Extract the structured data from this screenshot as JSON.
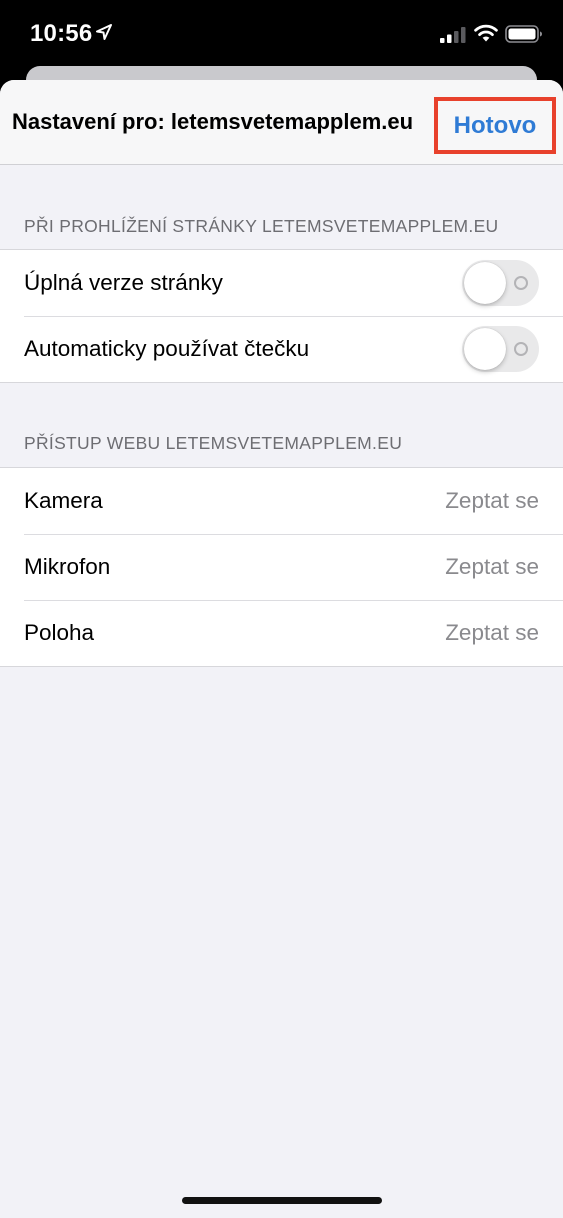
{
  "status_bar": {
    "time": "10:56"
  },
  "nav": {
    "title": "Nastavení pro: letemsvetemapplem.eu",
    "done_label": "Hotovo"
  },
  "sections": [
    {
      "header": "Při prohlížení stránky letemsvetemapplem.eu",
      "rows": [
        {
          "label": "Úplná verze stránky",
          "toggle": false
        },
        {
          "label": "Automaticky používat čtečku",
          "toggle": false
        }
      ]
    },
    {
      "header": "Přístup webu letemsvetemapplem.eu",
      "rows": [
        {
          "label": "Kamera",
          "value": "Zeptat se"
        },
        {
          "label": "Mikrofon",
          "value": "Zeptat se"
        },
        {
          "label": "Poloha",
          "value": "Zeptat se"
        }
      ]
    }
  ],
  "colors": {
    "accent": "#2f7bd5",
    "highlight_border": "#e8412c",
    "toggle_off": "#e9e9ea",
    "secondary_text": "#8a8a8e"
  },
  "icons": [
    "location-arrow-icon",
    "cellular-signal-icon",
    "wifi-icon",
    "battery-icon"
  ]
}
